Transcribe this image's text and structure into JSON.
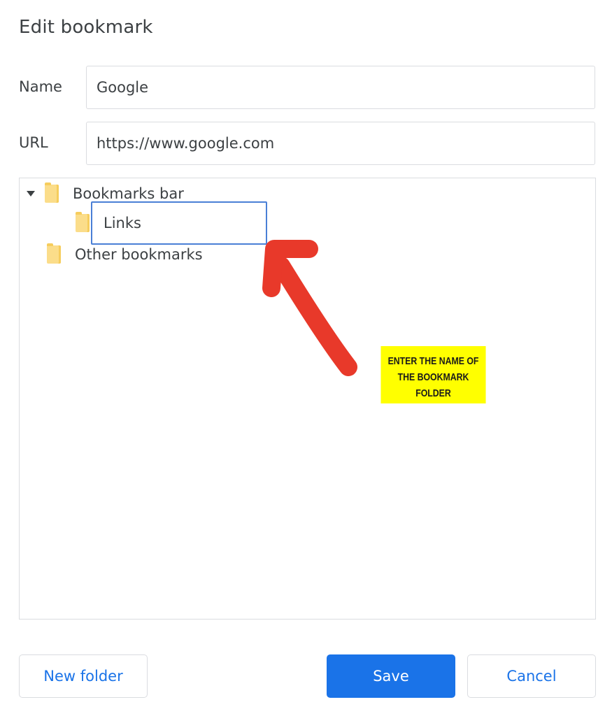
{
  "dialog": {
    "title": "Edit bookmark"
  },
  "form": {
    "name_label": "Name",
    "name_value": "Google",
    "url_label": "URL",
    "url_value": "https://www.google.com"
  },
  "tree": {
    "items": [
      {
        "label": "Bookmarks bar",
        "expanded": true,
        "icon": "folder-icon"
      },
      {
        "label": "Links",
        "editing": true,
        "icon": "folder-icon"
      },
      {
        "label": "Other bookmarks",
        "icon": "folder-icon"
      }
    ]
  },
  "annotation": {
    "line1": "ENTER THE NAME OF",
    "line2": "THE BOOKMARK",
    "line3": "FOLDER",
    "arrow_color": "#e8392a",
    "note_color": "#ffff00"
  },
  "buttons": {
    "new_folder": "New folder",
    "save": "Save",
    "cancel": "Cancel"
  },
  "colors": {
    "accent": "#1a73e8",
    "border": "#dadce0",
    "focus": "#4a7fd6",
    "folder": "#fbdd8a"
  }
}
